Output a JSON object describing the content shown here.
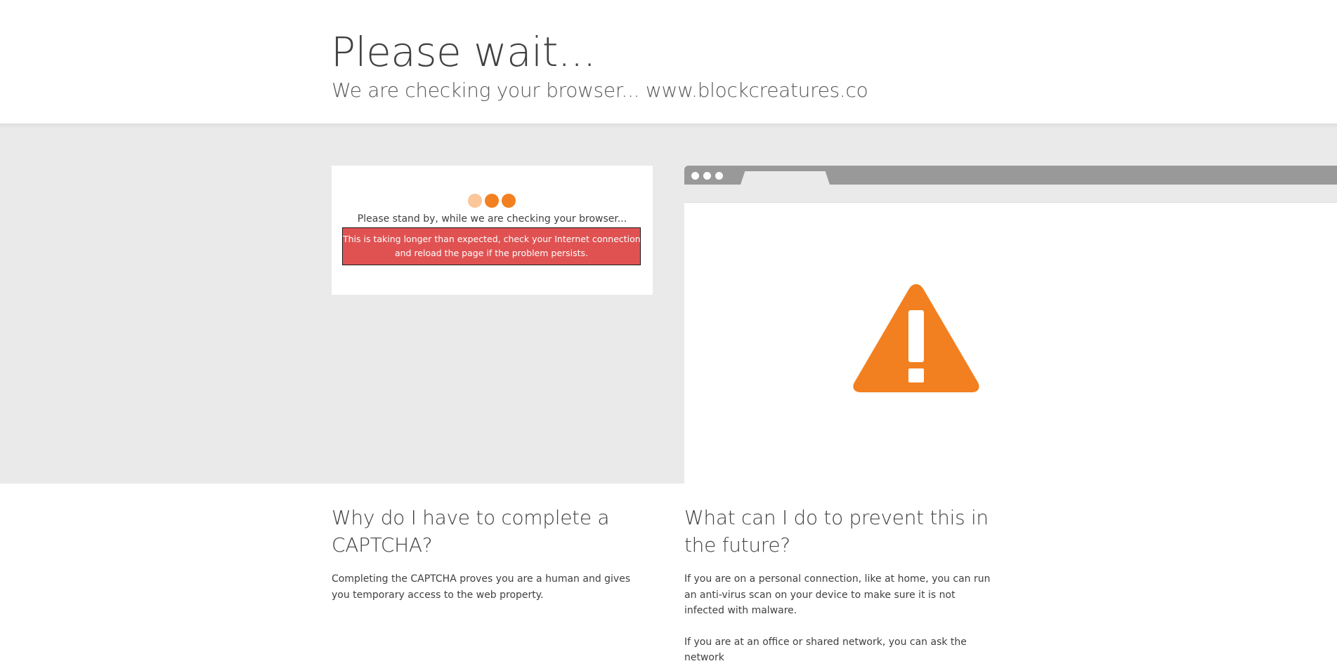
{
  "header": {
    "title": "Please wait...",
    "subtitle": "We are checking your browser... www.blockcreatures.co"
  },
  "status": {
    "message": "Please stand by, while we are checking your browser...",
    "error_line1": "This is taking longer than expected, check your Internet connection",
    "error_line2": "and reload the page if the problem persists."
  },
  "illustration": {
    "icon": "warning-triangle-icon",
    "accent_color": "#f38020"
  },
  "info": {
    "left": {
      "heading": "Why do I have to complete a CAPTCHA?",
      "body": "Completing the CAPTCHA proves you are a human and gives you temporary access to the web property."
    },
    "right": {
      "heading": "What can I do to prevent this in the future?",
      "body1": "If you are on a personal connection, like at home, you can run an anti-virus scan on your device to make sure it is not infected with malware.",
      "body2": "If you are at an office or shared network, you can ask the network"
    }
  },
  "colors": {
    "error_background": "#e05252",
    "band_background": "#eaeaea",
    "browser_bar": "#999999"
  }
}
